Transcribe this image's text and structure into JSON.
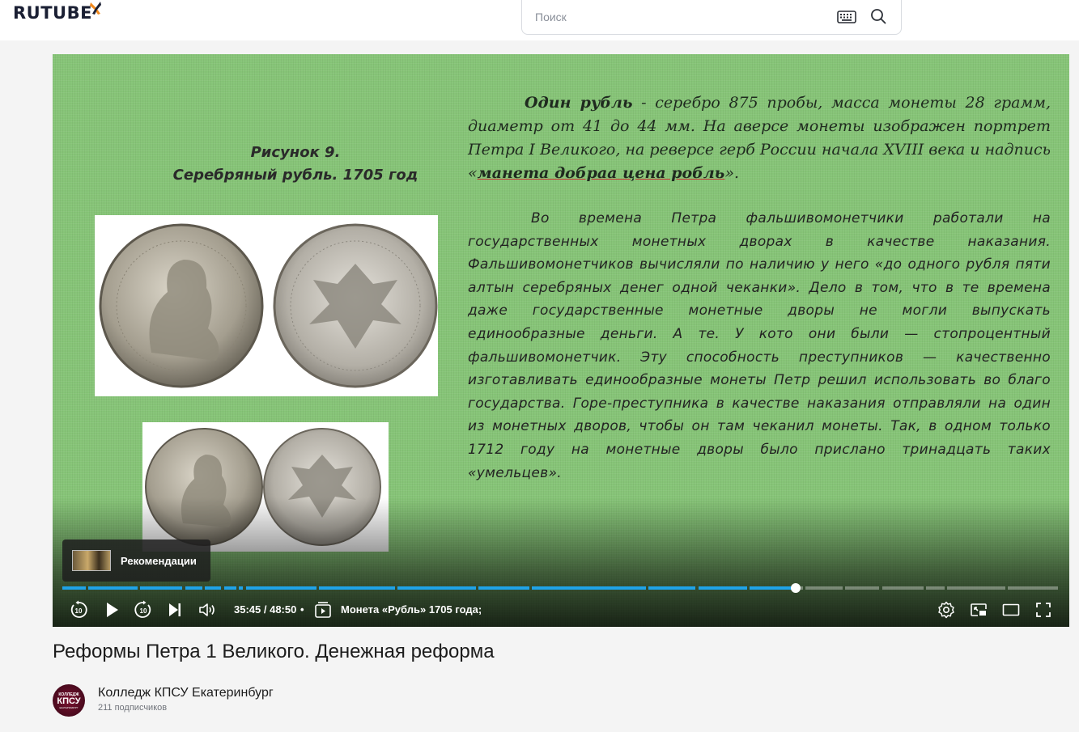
{
  "header": {
    "logo": "RUTUBE",
    "search_placeholder": "Поиск"
  },
  "player": {
    "slide": {
      "caption_line1": "Рисунок 9.",
      "caption_line2": "Серебряный рубль. 1705 год",
      "para1_bold": "Один рубль",
      "para1_text": " - серебро 875 пробы, масса монеты 28 грамм, диаметр от 41 до 44 мм. На аверсе монеты изображен портрет Петра I Великого, на реверсе герб России начала XVIII века и надпись «",
      "para1_underlined": "манета добраа цена робль",
      "para1_end": "».",
      "para2": "Во времена Петра фальшивомонетчики работали на государственных монетных дворах в качестве наказания. Фальшивомонетчиков вычисляли по наличию у него «до одного рубля пяти алтын серебряных денег одной чеканки». Дело в том, что в те времена даже государственные монетные дворы не могли выпускать единообразные деньги. А те. У кото они были — стопроцентный фальшивомонетчик. Эту способность преступников — качественно изготавливать единообразные монеты Петр решил использовать во благо государства. Горе-преступника в качестве наказания отправляли на один из монетных дворов, чтобы он там чеканил монеты. Так, в одном только 1712 году на монетные дворы было прислано тринадцать таких «умельцев»."
    },
    "recommendations_label": "Рекомендации",
    "progress": {
      "played_fraction": 0.735,
      "segments": [
        {
          "start": 0.0,
          "end": 0.025
        },
        {
          "start": 0.026,
          "end": 0.077
        },
        {
          "start": 0.078,
          "end": 0.122
        },
        {
          "start": 0.123,
          "end": 0.142
        },
        {
          "start": 0.143,
          "end": 0.161
        },
        {
          "start": 0.162,
          "end": 0.176
        },
        {
          "start": 0.177,
          "end": 0.183
        },
        {
          "start": 0.184,
          "end": 0.256
        },
        {
          "start": 0.257,
          "end": 0.335
        },
        {
          "start": 0.336,
          "end": 0.416
        },
        {
          "start": 0.417,
          "end": 0.47
        },
        {
          "start": 0.471,
          "end": 0.587
        },
        {
          "start": 0.588,
          "end": 0.637
        },
        {
          "start": 0.638,
          "end": 0.688
        },
        {
          "start": 0.689,
          "end": 0.744
        },
        {
          "start": 0.745,
          "end": 0.784
        },
        {
          "start": 0.785,
          "end": 0.821
        },
        {
          "start": 0.822,
          "end": 0.865
        },
        {
          "start": 0.866,
          "end": 0.886
        },
        {
          "start": 0.887,
          "end": 0.947
        },
        {
          "start": 0.948,
          "end": 1.0
        }
      ]
    },
    "time_current": "35:45",
    "time_total": "48:50",
    "time_display": "35:45 / 48:50",
    "separator": "•",
    "chapter_title": "Монета «Рубль» 1705 года;",
    "icons": {
      "rewind": "replay-10-icon",
      "play": "play-icon",
      "forward": "forward-10-icon",
      "next": "skip-next-icon",
      "volume": "volume-icon",
      "chapters": "chapters-icon",
      "settings": "gear-icon",
      "pip": "picture-in-picture-icon",
      "theater": "theater-mode-icon",
      "fullscreen": "fullscreen-icon"
    },
    "accent_color": "#1fa3e8"
  },
  "video": {
    "title": "Реформы Петра 1 Великого. Денежная реформа"
  },
  "channel": {
    "name": "Колледж КПСУ Екатеринбург",
    "subscribers": "211 подписчиков",
    "avatar_line1": "КОЛЛЕДЖ",
    "avatar_line2": "КПСУ",
    "avatar_line3": "ЕКАТЕРИНБУРГ"
  }
}
